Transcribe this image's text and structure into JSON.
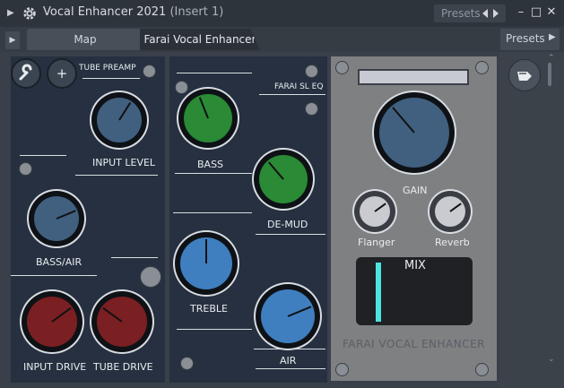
{
  "titlebar": {
    "title": "Vocal Enhancer 2021",
    "insert": "(Insert 1)",
    "presets_label": "Presets",
    "minimize": "–",
    "maximize": "□",
    "close": "✕"
  },
  "tabs": {
    "map": "Map",
    "farai": "Farai Vocal Enhancer",
    "presets": "Presets"
  },
  "tube_preamp": {
    "header": "TUBE PREAMP",
    "input_level": "INPUT LEVEL",
    "bass_air": "BASS/AIR",
    "input_drive": "INPUT DRIVE",
    "tube_drive": "TUBE DRIVE",
    "knob_levels": {
      "input_level": 0.62,
      "bass_air": 0.75,
      "input_drive": 0.7,
      "tube_drive": 0.3
    }
  },
  "eq": {
    "header": "FARAI SL EQ",
    "bass": "BASS",
    "de_mud": "DE-MUD",
    "treble": "TREBLE",
    "air": "AIR",
    "knob_levels": {
      "bass": 0.42,
      "de_mud": 0.35,
      "treble": 0.5,
      "air": 0.75
    }
  },
  "master": {
    "gain": "GAIN",
    "flanger": "Flanger",
    "reverb": "Reverb",
    "mix": "MIX",
    "brand": "FARAI VOCAL ENHANCER",
    "knob_levels": {
      "gain": 0.35,
      "flanger": 0.7,
      "reverb": 0.7
    },
    "mix_level": 0.15
  },
  "colors": {
    "panel": "#263040",
    "knob_blue": "#416080",
    "knob_green": "#2a8a35",
    "knob_lightblue": "#3f7fc0",
    "knob_red": "#7a1f22",
    "mix_accent": "#4ee3df"
  },
  "icons": {
    "wrench": "wrench-icon",
    "plus": "plus-icon",
    "gear": "gear-icon",
    "side": "plugin-icon"
  }
}
